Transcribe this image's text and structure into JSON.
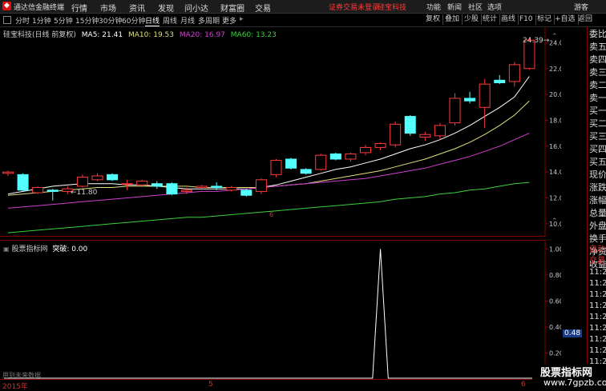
{
  "titlebar": {
    "app_title": "通达信金融终端",
    "menu": [
      "行情",
      "市场",
      "资讯",
      "发现",
      "问小达",
      "财富圈",
      "交易"
    ],
    "notice": "证券交易未登录",
    "stock_name": "硅宝科技",
    "right_menu": [
      "功能",
      "新闻",
      "社区",
      "选项"
    ],
    "user": "游客"
  },
  "toolbar": {
    "periods": [
      "分时",
      "1分钟",
      "5分钟",
      "15分钟",
      "30分钟",
      "60分钟",
      "日线",
      "周线",
      "月线",
      "多周期",
      "更多"
    ],
    "active_period": "日线",
    "right_buttons": [
      "复权",
      "叠加",
      "少股",
      "统计",
      "画线",
      "F10",
      "标记",
      "+自选",
      "返回"
    ]
  },
  "main_legend": {
    "title": "硅宝科技(日线 前复权)",
    "ma5": "MA5: 21.41",
    "ma10": "MA10: 19.53",
    "ma20": "MA20: 16.97",
    "ma60": "MA60: 13.23"
  },
  "indicator_legend": {
    "title": "股票指标网",
    "value": "突破: 0.00"
  },
  "annotations": {
    "low_price": "11.80",
    "high_price": "24.39",
    "date_marker": "6",
    "indicator_last": "0.48",
    "bottom_left": "用到未来数据"
  },
  "x_axis": {
    "labels": [
      "2015年",
      "5",
      "6"
    ]
  },
  "colors": {
    "up": "#ff3b3b",
    "down": "#54ffff",
    "ma5": "#ffffff",
    "ma10": "#e0e07a",
    "ma20": "#d040d0",
    "ma60": "#3cd23c",
    "grid": "#8a0000"
  },
  "right_panel": [
    "委比",
    "卖五",
    "卖四",
    "卖三",
    "卖二",
    "卖一",
    "买一",
    "买二",
    "买三",
    "买四",
    "买五",
    "现价",
    "涨跌",
    "涨幅",
    "总量",
    "外盘",
    "换手",
    "净资",
    "收益"
  ],
  "right_panel_bottom": [
    "自动",
    "交易",
    "11:2",
    "11:2",
    "11:2",
    "11:2",
    "11:2",
    "11:2",
    "11:2",
    "11:2",
    "11:2",
    "11:2"
  ],
  "watermark": {
    "line1": "股票指标网",
    "line2": "www.7gpzb.com"
  },
  "chart_data": [
    {
      "type": "candlestick",
      "title": "硅宝科技(日线 前复权)",
      "y_ticks": [
        10.0,
        12.0,
        14.0,
        16.0,
        18.0,
        20.0,
        22.0,
        24.0
      ],
      "ylim": [
        9.0,
        25.2
      ],
      "candles": [
        {
          "o": 13.9,
          "h": 14.1,
          "l": 13.7,
          "c": 14.0
        },
        {
          "o": 13.8,
          "h": 13.9,
          "l": 12.5,
          "c": 12.6
        },
        {
          "o": 12.4,
          "h": 12.9,
          "l": 12.3,
          "c": 12.8
        },
        {
          "o": 12.6,
          "h": 12.7,
          "l": 11.8,
          "c": 12.5
        },
        {
          "o": 12.5,
          "h": 12.9,
          "l": 12.3,
          "c": 12.7
        },
        {
          "o": 12.9,
          "h": 13.8,
          "l": 12.8,
          "c": 13.6
        },
        {
          "o": 13.4,
          "h": 13.9,
          "l": 13.3,
          "c": 13.7
        },
        {
          "o": 13.8,
          "h": 13.9,
          "l": 13.3,
          "c": 13.4
        },
        {
          "o": 13.1,
          "h": 13.4,
          "l": 12.6,
          "c": 13.1
        },
        {
          "o": 13.0,
          "h": 13.4,
          "l": 12.9,
          "c": 13.3
        },
        {
          "o": 13.1,
          "h": 13.3,
          "l": 12.7,
          "c": 12.9
        },
        {
          "o": 13.1,
          "h": 13.2,
          "l": 12.2,
          "c": 12.3
        },
        {
          "o": 12.5,
          "h": 12.8,
          "l": 12.3,
          "c": 12.6
        },
        {
          "o": 12.8,
          "h": 13.0,
          "l": 12.6,
          "c": 12.9
        },
        {
          "o": 12.9,
          "h": 13.2,
          "l": 12.6,
          "c": 12.8
        },
        {
          "o": 12.6,
          "h": 12.9,
          "l": 12.5,
          "c": 12.8
        },
        {
          "o": 12.6,
          "h": 12.7,
          "l": 12.1,
          "c": 12.2
        },
        {
          "o": 12.5,
          "h": 13.5,
          "l": 12.3,
          "c": 13.4
        },
        {
          "o": 13.8,
          "h": 15.0,
          "l": 13.6,
          "c": 14.9
        },
        {
          "o": 15.0,
          "h": 15.1,
          "l": 14.2,
          "c": 14.3
        },
        {
          "o": 14.2,
          "h": 14.3,
          "l": 13.8,
          "c": 13.9
        },
        {
          "o": 14.2,
          "h": 15.4,
          "l": 14.1,
          "c": 15.3
        },
        {
          "o": 15.4,
          "h": 15.5,
          "l": 14.9,
          "c": 15.0
        },
        {
          "o": 15.0,
          "h": 15.5,
          "l": 14.8,
          "c": 15.4
        },
        {
          "o": 15.5,
          "h": 16.1,
          "l": 15.3,
          "c": 15.9
        },
        {
          "o": 15.9,
          "h": 16.3,
          "l": 15.7,
          "c": 16.2
        },
        {
          "o": 16.1,
          "h": 17.9,
          "l": 15.9,
          "c": 17.7
        },
        {
          "o": 18.3,
          "h": 18.4,
          "l": 16.8,
          "c": 17.0
        },
        {
          "o": 16.7,
          "h": 17.1,
          "l": 16.4,
          "c": 16.9
        },
        {
          "o": 16.8,
          "h": 17.8,
          "l": 16.5,
          "c": 17.6
        },
        {
          "o": 17.8,
          "h": 20.1,
          "l": 17.6,
          "c": 19.7
        },
        {
          "o": 19.7,
          "h": 20.2,
          "l": 19.3,
          "c": 19.5
        },
        {
          "o": 19.0,
          "h": 21.2,
          "l": 17.4,
          "c": 20.8
        },
        {
          "o": 21.1,
          "h": 21.5,
          "l": 20.8,
          "c": 20.9
        },
        {
          "o": 21.0,
          "h": 22.5,
          "l": 20.6,
          "c": 22.3
        },
        {
          "o": 22.0,
          "h": 24.4,
          "l": 21.9,
          "c": 24.2
        }
      ],
      "ma": [
        {
          "name": "MA5",
          "values": [
            12.3,
            12.5,
            12.7,
            12.9,
            13.0,
            13.1,
            13.1,
            13.1,
            13.0,
            13.0,
            12.9,
            12.8,
            12.7,
            12.7,
            12.7,
            12.7,
            12.7,
            12.8,
            13.0,
            13.3,
            13.6,
            13.9,
            14.2,
            14.4,
            14.7,
            15.0,
            15.4,
            15.8,
            16.1,
            16.5,
            17.0,
            17.6,
            18.3,
            19.0,
            19.8,
            21.4
          ]
        },
        {
          "name": "MA10",
          "values": [
            12.2,
            12.3,
            12.4,
            12.5,
            12.6,
            12.7,
            12.8,
            12.8,
            12.9,
            12.9,
            12.9,
            12.9,
            12.9,
            12.8,
            12.8,
            12.8,
            12.8,
            12.8,
            12.9,
            13.0,
            13.1,
            13.3,
            13.5,
            13.7,
            13.9,
            14.1,
            14.4,
            14.7,
            15.0,
            15.4,
            15.8,
            16.3,
            16.9,
            17.6,
            18.4,
            19.5
          ]
        },
        {
          "name": "MA20",
          "values": [
            11.2,
            11.3,
            11.4,
            11.5,
            11.6,
            11.7,
            11.8,
            11.9,
            12.0,
            12.1,
            12.2,
            12.3,
            12.4,
            12.5,
            12.5,
            12.6,
            12.7,
            12.8,
            12.9,
            13.0,
            13.1,
            13.2,
            13.3,
            13.4,
            13.5,
            13.7,
            13.9,
            14.1,
            14.3,
            14.6,
            14.9,
            15.2,
            15.6,
            16.0,
            16.5,
            17.0
          ]
        },
        {
          "name": "MA60",
          "values": [
            9.3,
            9.4,
            9.5,
            9.6,
            9.7,
            9.8,
            9.9,
            10.0,
            10.1,
            10.2,
            10.3,
            10.4,
            10.5,
            10.5,
            10.6,
            10.7,
            10.8,
            10.9,
            11.0,
            11.1,
            11.2,
            11.3,
            11.4,
            11.5,
            11.6,
            11.7,
            11.9,
            12.0,
            12.1,
            12.3,
            12.4,
            12.6,
            12.7,
            12.9,
            13.1,
            13.2
          ]
        }
      ]
    },
    {
      "type": "line",
      "title": "股票指标网",
      "series": [
        {
          "name": "突破",
          "values": [
            0,
            0,
            0,
            0,
            0,
            0,
            0,
            0,
            0,
            0,
            0,
            0,
            0,
            0,
            0,
            0,
            0,
            0,
            0,
            0,
            0,
            0,
            0,
            0,
            0,
            0,
            0,
            0,
            0,
            0,
            0,
            0,
            0,
            0,
            0,
            0,
            0,
            0,
            0,
            0,
            0,
            0,
            0,
            0,
            0,
            0,
            0,
            0,
            1,
            0,
            0,
            0,
            0,
            0,
            0,
            0,
            0,
            0,
            0,
            0,
            0,
            0,
            0,
            0,
            0,
            0,
            0,
            0,
            0,
            0
          ]
        }
      ],
      "y_ticks": [
        0.2,
        0.4,
        0.6,
        0.8,
        1.0
      ],
      "ylim": [
        0,
        1.07
      ]
    }
  ]
}
